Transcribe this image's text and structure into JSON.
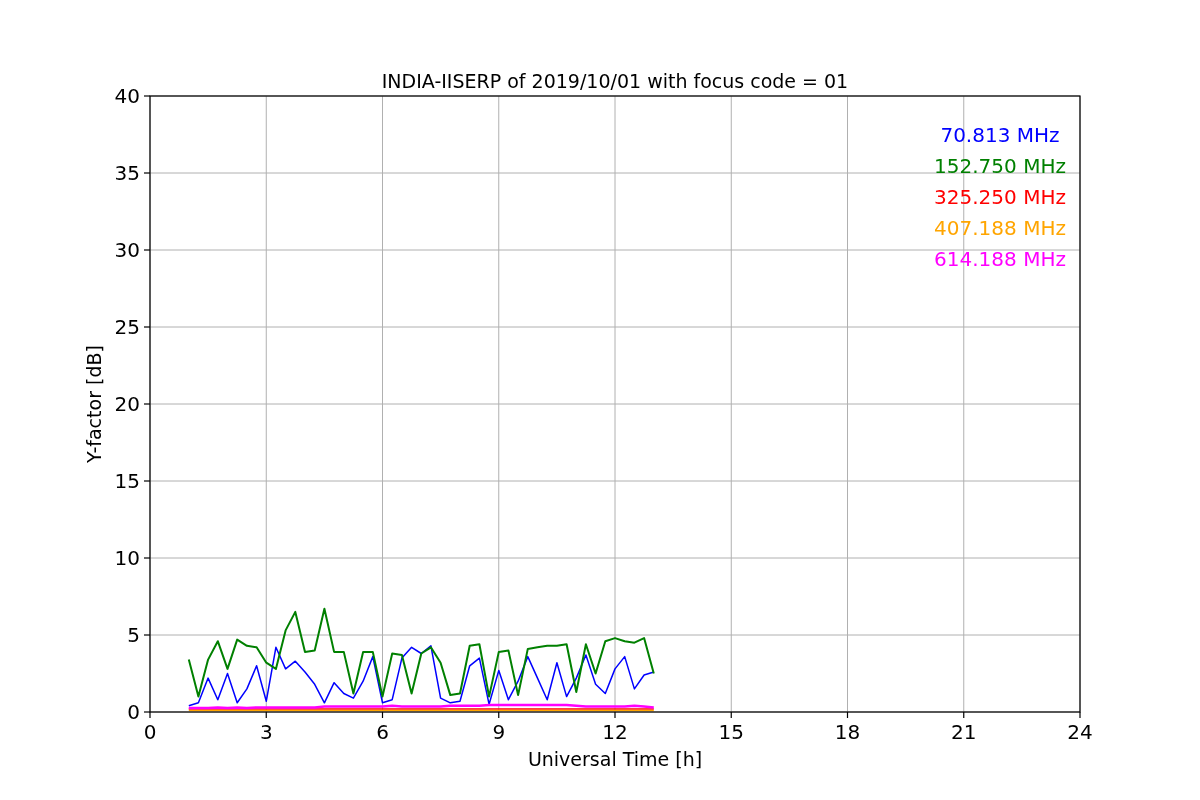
{
  "figure": {
    "chart_data": {
      "type": "line",
      "title": "INDIA-IISERP of 2019/10/01 with focus code = 01",
      "xlabel": "Universal Time [h]",
      "ylabel": "Y-factor [dB]",
      "grid": true,
      "xlim": [
        0,
        24
      ],
      "ylim": [
        0,
        40
      ],
      "xticks": [
        0,
        3,
        6,
        9,
        12,
        15,
        18,
        21,
        24
      ],
      "yticks": [
        0,
        5,
        10,
        15,
        20,
        25,
        30,
        35,
        40
      ],
      "x": [
        1,
        1.25,
        1.5,
        1.75,
        2,
        2.25,
        2.5,
        2.75,
        3,
        3.25,
        3.5,
        3.75,
        4,
        4.25,
        4.5,
        4.75,
        5,
        5.25,
        5.5,
        5.75,
        6,
        6.25,
        6.5,
        6.75,
        7,
        7.25,
        7.5,
        7.75,
        8,
        8.25,
        8.5,
        8.75,
        9,
        9.25,
        9.5,
        9.75,
        10,
        10.25,
        10.5,
        10.75,
        11,
        11.25,
        11.5,
        11.75,
        12,
        12.25,
        12.5,
        12.75,
        13
      ],
      "series": [
        {
          "name": "70.813 MHz",
          "color": "#0000ff",
          "values": [
            0.4,
            0.6,
            2.2,
            0.8,
            2.5,
            0.6,
            1.5,
            3.0,
            0.7,
            4.2,
            2.8,
            3.3,
            2.6,
            1.8,
            0.6,
            1.9,
            1.2,
            0.9,
            2.0,
            3.6,
            0.6,
            0.8,
            3.5,
            4.2,
            3.8,
            4.3,
            0.9,
            0.6,
            0.7,
            3.0,
            3.5,
            0.5,
            2.7,
            0.8,
            2.0,
            3.6,
            2.2,
            0.8,
            3.2,
            1.0,
            2.2,
            3.7,
            1.8,
            1.2,
            2.8,
            3.6,
            1.5,
            2.4,
            2.6
          ]
        },
        {
          "name": "152.750 MHz",
          "color": "#008000",
          "values": [
            3.4,
            1.0,
            3.4,
            4.6,
            2.8,
            4.7,
            4.3,
            4.2,
            3.2,
            2.8,
            5.3,
            6.5,
            3.9,
            4.0,
            6.7,
            3.9,
            3.9,
            1.2,
            3.9,
            3.9,
            1.0,
            3.8,
            3.7,
            1.2,
            3.8,
            4.2,
            3.2,
            1.1,
            1.2,
            4.3,
            4.4,
            1.0,
            3.9,
            4.0,
            1.1,
            4.1,
            4.2,
            4.3,
            4.3,
            4.4,
            1.3,
            4.4,
            2.5,
            4.6,
            4.8,
            4.6,
            4.5,
            4.8,
            2.5
          ]
        },
        {
          "name": "325.250 MHz",
          "color": "#ff0000",
          "values": [
            0.2,
            0.2,
            0.2,
            0.2,
            0.2,
            0.2,
            0.2,
            0.2,
            0.2,
            0.2,
            0.2,
            0.2,
            0.2,
            0.2,
            0.2,
            0.2,
            0.2,
            0.2,
            0.2,
            0.2,
            0.2,
            0.2,
            0.2,
            0.2,
            0.2,
            0.2,
            0.2,
            0.2,
            0.2,
            0.2,
            0.2,
            0.2,
            0.2,
            0.2,
            0.2,
            0.2,
            0.2,
            0.2,
            0.2,
            0.2,
            0.2,
            0.2,
            0.2,
            0.2,
            0.2,
            0.2,
            0.2,
            0.2,
            0.2
          ]
        },
        {
          "name": "407.188 MHz",
          "color": "#ffa500",
          "values": [
            0.1,
            0.1,
            0.1,
            0.1,
            0.1,
            0.1,
            0.1,
            0.1,
            0.1,
            0.1,
            0.1,
            0.1,
            0.1,
            0.1,
            0.1,
            0.1,
            0.1,
            0.1,
            0.1,
            0.1,
            0.1,
            0.1,
            0.1,
            0.1,
            0.1,
            0.1,
            0.1,
            0.1,
            0.1,
            0.1,
            0.1,
            0.1,
            0.1,
            0.1,
            0.1,
            0.1,
            0.1,
            0.1,
            0.1,
            0.1,
            0.1,
            0.1,
            0.1,
            0.1,
            0.1,
            0.1,
            0.1,
            0.1,
            0.1
          ]
        },
        {
          "name": "614.188 MHz",
          "color": "#ff00ff",
          "values": [
            0.25,
            0.25,
            0.25,
            0.3,
            0.25,
            0.3,
            0.25,
            0.3,
            0.3,
            0.3,
            0.3,
            0.3,
            0.3,
            0.3,
            0.35,
            0.35,
            0.35,
            0.35,
            0.35,
            0.35,
            0.35,
            0.4,
            0.35,
            0.35,
            0.35,
            0.35,
            0.35,
            0.4,
            0.4,
            0.4,
            0.4,
            0.45,
            0.45,
            0.45,
            0.45,
            0.45,
            0.45,
            0.45,
            0.45,
            0.45,
            0.4,
            0.35,
            0.35,
            0.35,
            0.35,
            0.35,
            0.4,
            0.35,
            0.3
          ]
        }
      ]
    }
  }
}
